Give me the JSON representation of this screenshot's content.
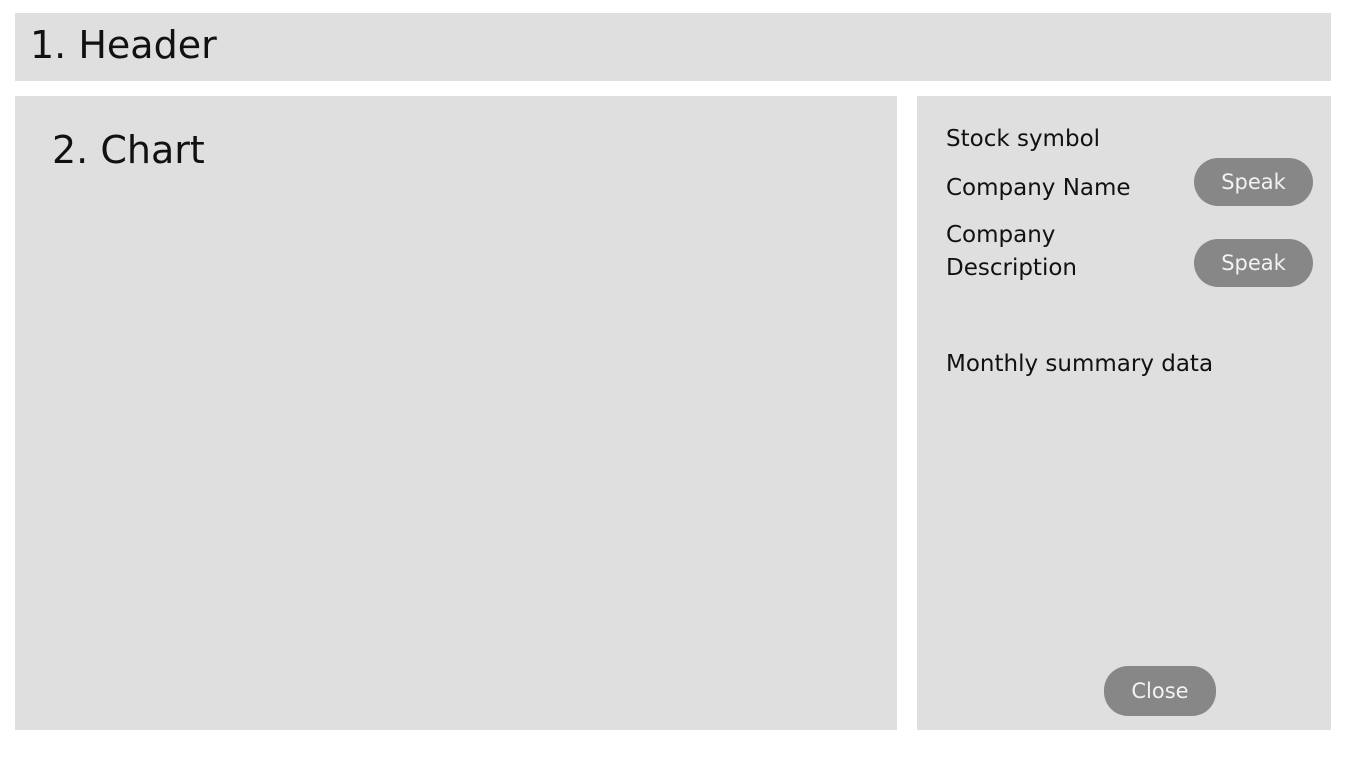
{
  "header": {
    "title": "1. Header"
  },
  "chart": {
    "title": "2. Chart"
  },
  "side_panel": {
    "stock_symbol_label": "Stock symbol",
    "company_name_label": "Company Name",
    "company_description_label": "Company Description",
    "speak_name_button": "Speak",
    "speak_description_button": "Speak",
    "monthly_summary_label": "Monthly summary data",
    "close_button": "Close"
  },
  "colors": {
    "panel_background": "#dfdfdf",
    "button_background": "#878787",
    "button_text": "#f2f2f2"
  }
}
